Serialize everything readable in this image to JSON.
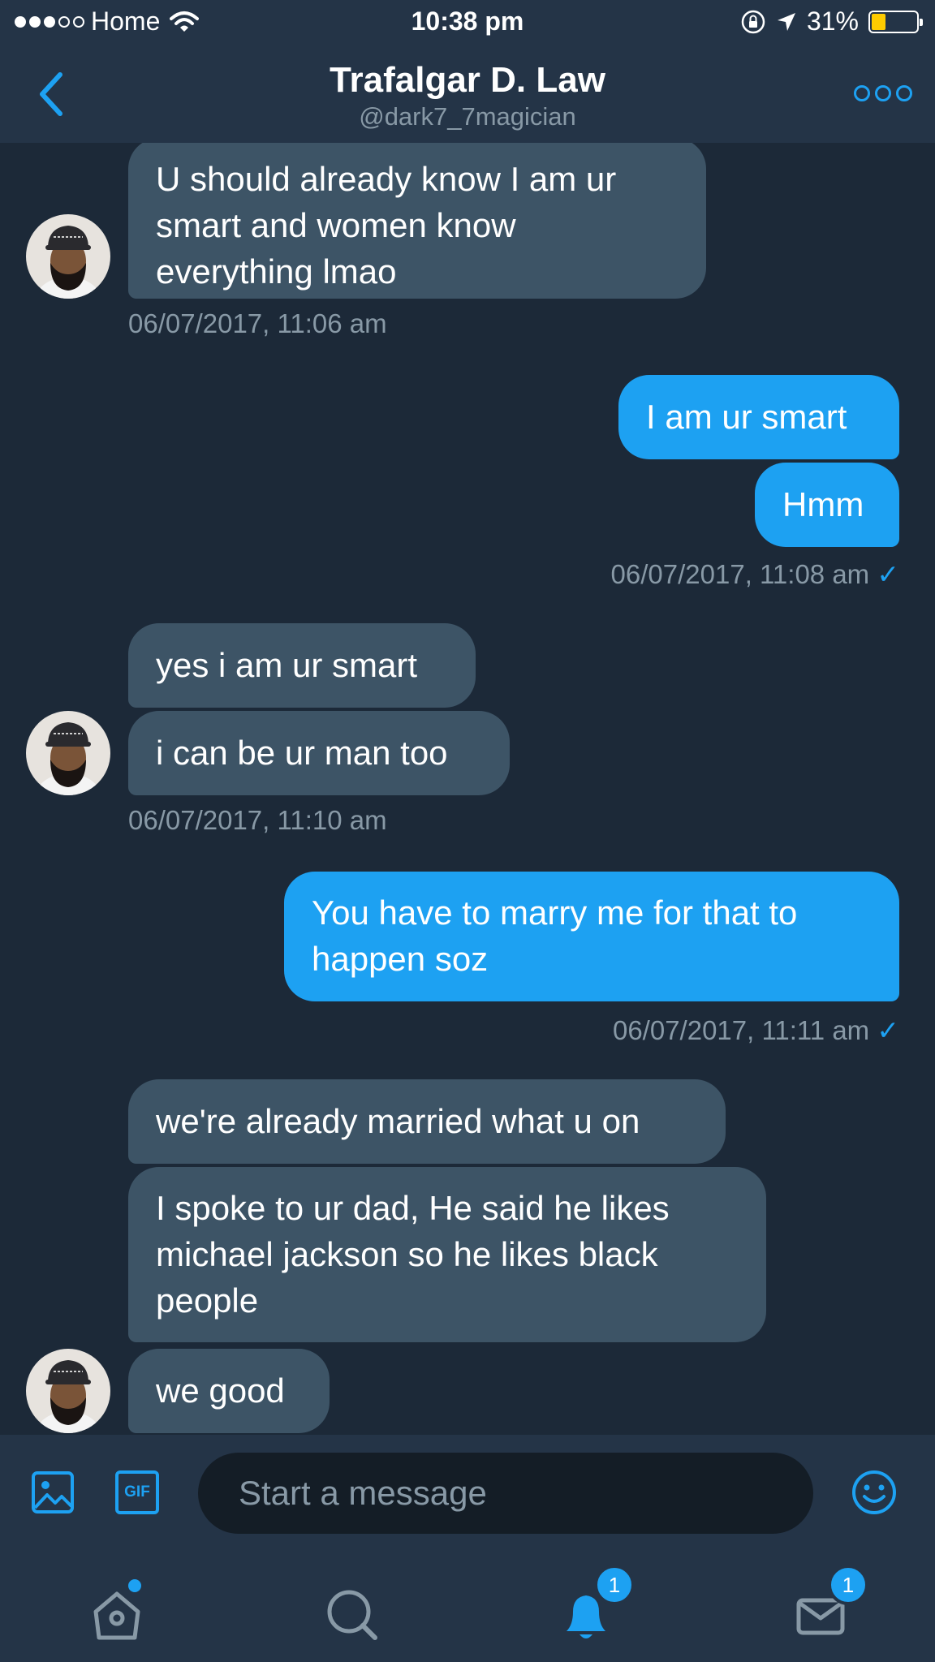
{
  "status_bar": {
    "carrier": "Home",
    "time": "10:38 pm",
    "battery": "31%",
    "battery_level": 0.31
  },
  "header": {
    "title": "Trafalgar D. Law",
    "handle": "@dark7_7magician"
  },
  "conversation": {
    "group1": {
      "message1": "U should already know I am ur\nsmart and women know\neverything lmao",
      "timestamp": "06/07/2017, 11:06 am"
    },
    "group2": {
      "message1": "I am ur smart",
      "message2": "Hmm",
      "timestamp": "06/07/2017, 11:08 am",
      "read_mark": "✓"
    },
    "group3": {
      "message1": "yes i am ur smart",
      "message2": "i can be ur man too",
      "timestamp": "06/07/2017, 11:10 am"
    },
    "group4": {
      "message1": "You have to marry me for that to\nhappen soz",
      "timestamp": "06/07/2017, 11:11 am",
      "read_mark": "✓"
    },
    "group5": {
      "message1": "we're already married what u on",
      "message2": "I spoke to ur dad, He said he likes\nmichael jackson so he likes black\npeople",
      "message3": "we good"
    }
  },
  "composer": {
    "placeholder": "Start a message",
    "gif_label": "GIF"
  },
  "tabbar": {
    "notifications_badge": "1",
    "messages_badge": "1"
  },
  "colors": {
    "accent": "#1da1f2",
    "background": "#1c2938",
    "bar": "#243447",
    "incoming_bubble": "#3d5466"
  }
}
